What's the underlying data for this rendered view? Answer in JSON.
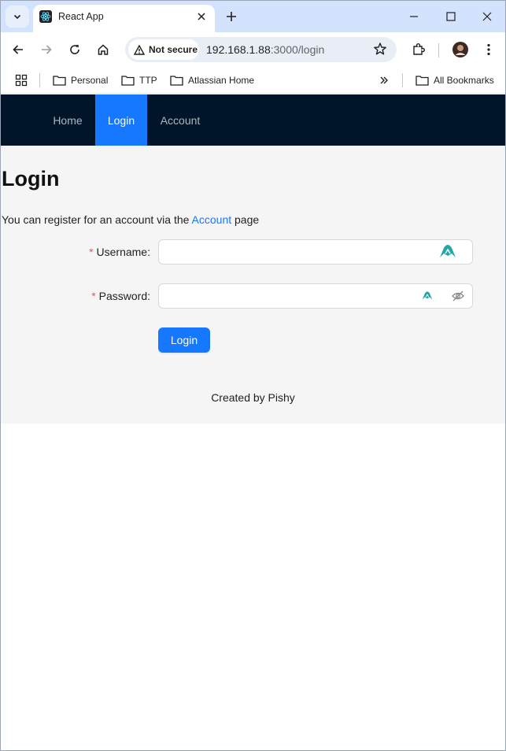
{
  "browser": {
    "tab_title": "React App",
    "security_label": "Not secure",
    "url_host": "192.168.1.88",
    "url_rest": ":3000/login",
    "icons": {
      "tab_search": "chevron-down-icon",
      "favicon": "react-icon",
      "close": "close-icon",
      "new_tab": "plus-icon",
      "back": "back-arrow-icon",
      "forward": "forward-arrow-icon",
      "reload": "reload-icon",
      "home": "home-icon",
      "warning": "warning-triangle-icon",
      "bookmark_star": "star-icon",
      "extensions": "puzzle-icon",
      "profile": "avatar-icon",
      "menu": "kebab-menu-icon",
      "apps": "apps-grid-icon",
      "folder": "folder-icon",
      "overflow": "double-chevron-icon"
    },
    "bookmarks": [
      {
        "label": "Personal"
      },
      {
        "label": "TTP"
      },
      {
        "label": "Atlassian Home"
      }
    ],
    "all_bookmarks_label": "All Bookmarks"
  },
  "nav": {
    "items": [
      {
        "label": "Home",
        "active": false
      },
      {
        "label": "Login",
        "active": true
      },
      {
        "label": "Account",
        "active": false
      }
    ],
    "background": "#001529",
    "active_color": "#1677ff"
  },
  "main": {
    "title": "Login",
    "intro_prefix": "You can register for an account via the ",
    "intro_link": "Account",
    "intro_suffix": " page",
    "form": {
      "username_label": "Username",
      "password_label": "Password",
      "username_value": "",
      "password_value": "",
      "required_mark": "*",
      "label_colon": ":",
      "submit_label": "Login"
    },
    "footer": "Created by Pishy"
  }
}
